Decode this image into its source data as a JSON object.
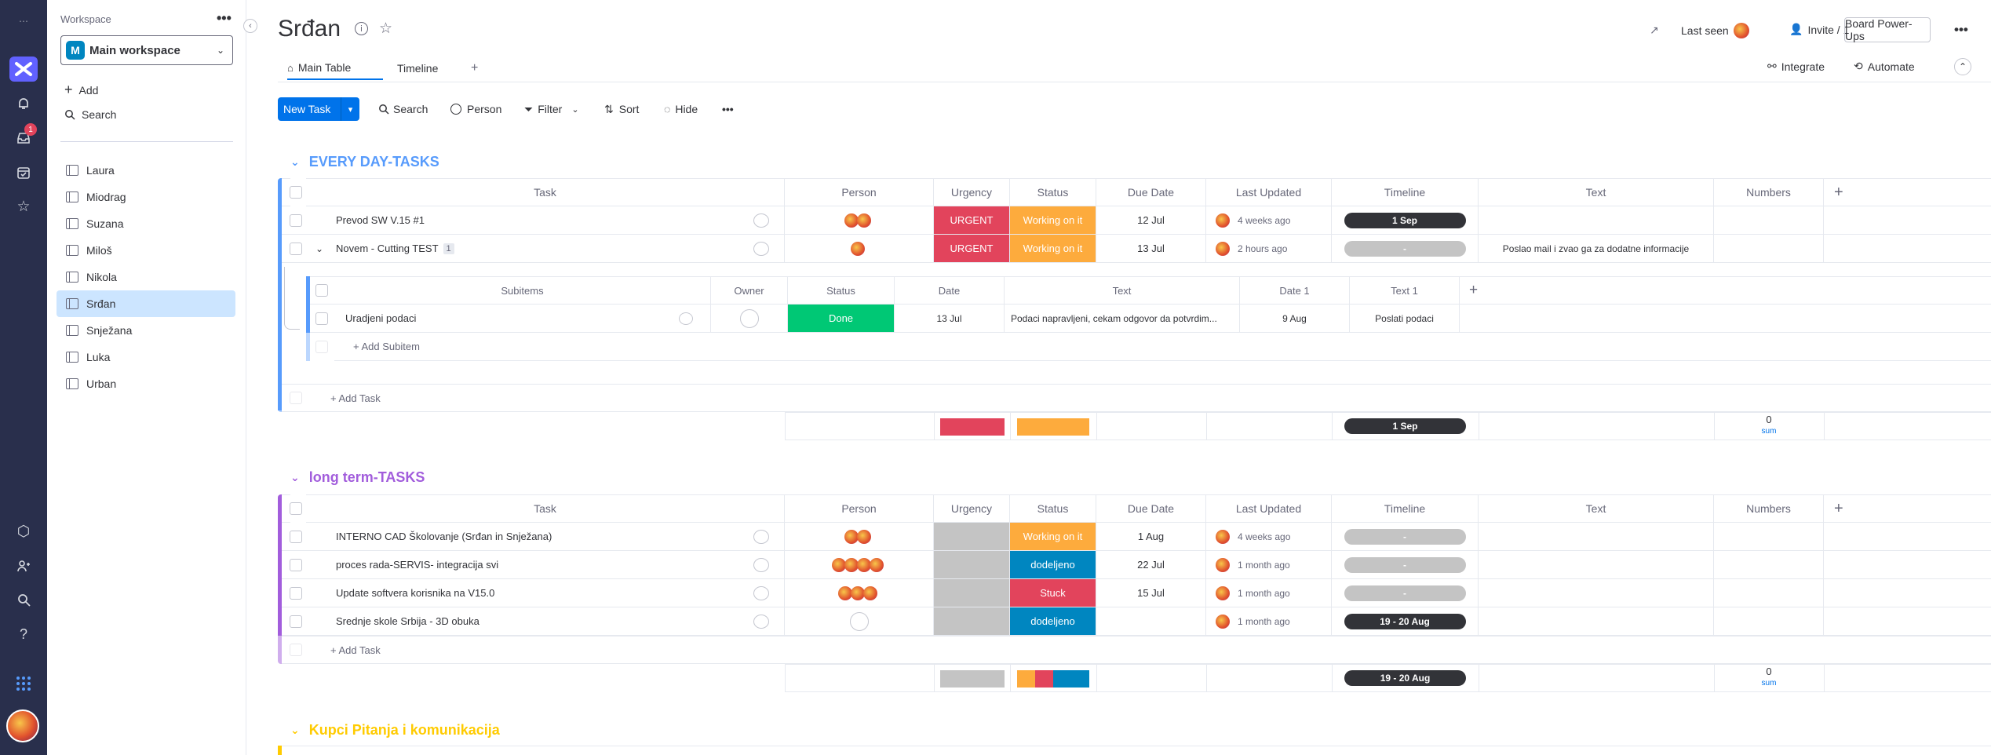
{
  "rail": {
    "badge": "1"
  },
  "sidebar": {
    "workspace_label": "Workspace",
    "workspace_name": "Main workspace",
    "workspace_initial": "M",
    "add_label": "Add",
    "search_label": "Search",
    "boards": [
      "Laura",
      "Miodrag",
      "Suzana",
      "Miloš",
      "Nikola",
      "Srđan",
      "Snježana",
      "Luka",
      "Urban"
    ],
    "selected": "Srđan"
  },
  "header": {
    "title": "Srđan",
    "last_seen": "Last seen",
    "invite": "Invite / 1",
    "power_ups": "Board Power-Ups",
    "tabs": [
      "Main Table",
      "Timeline",
      "+"
    ],
    "integrate": "Integrate",
    "automate": "Automate"
  },
  "toolbar": {
    "new_task": "New Task",
    "search": "Search",
    "person": "Person",
    "filter": "Filter",
    "sort": "Sort",
    "hide": "Hide"
  },
  "columns": [
    "Task",
    "Person",
    "Urgency",
    "Status",
    "Due Date",
    "Last Updated",
    "Timeline",
    "Text",
    "Numbers",
    "+"
  ],
  "colors": {
    "urgent": "#e2445c",
    "working": "#fdab3d",
    "done": "#00c875",
    "stuck": "#e2445c",
    "assigned": "#0086c0",
    "blank": "#c4c4c4",
    "group1": "#579bfc",
    "group2": "#a25ddc",
    "group3": "#ffcb00"
  },
  "groups": [
    {
      "title": "EVERY DAY-TASKS",
      "rows": [
        {
          "task": "Prevod SW V.15 #1",
          "urgency": "URGENT",
          "status": "Working on it",
          "due": "12 Jul",
          "updated": "4 weeks ago",
          "timeline": "1 Sep",
          "text": ""
        },
        {
          "task": "Novem - Cutting TEST",
          "sub_count": "1",
          "urgency": "URGENT",
          "status": "Working on it",
          "due": "13 Jul",
          "updated": "2 hours ago",
          "timeline": "-",
          "text": "Poslao mail i zvao ga za dodatne informacije"
        }
      ],
      "subitems": {
        "columns": [
          "Subitems",
          "Owner",
          "Status",
          "Date",
          "Text",
          "Date 1",
          "Text 1",
          "+"
        ],
        "rows": [
          {
            "name": "Uradjeni podaci",
            "status": "Done",
            "date": "13 Jul",
            "text": "Podaci napravljeni, cekam odgovor da potvrdim...",
            "date1": "9 Aug",
            "text1": "Poslati podaci"
          }
        ],
        "add": "+ Add Subitem"
      },
      "add_task": "+ Add Task",
      "summary": {
        "timeline": "1 Sep",
        "numbers": "0",
        "sum": "sum"
      }
    },
    {
      "title": "long term-TASKS",
      "rows": [
        {
          "task": "INTERNO CAD Školovanje (Srđan in Snježana)",
          "status": "Working on it",
          "due": "1 Aug",
          "updated": "4 weeks ago",
          "timeline": "-"
        },
        {
          "task": "proces rada-SERVIS- integracija svi",
          "status": "dodeljeno",
          "due": "22 Jul",
          "updated": "1 month ago",
          "timeline": "-"
        },
        {
          "task": "Update softvera korisnika na V15.0",
          "status": "Stuck",
          "due": "15 Jul",
          "updated": "1 month ago",
          "timeline": "-"
        },
        {
          "task": "Srednje skole Srbija - 3D obuka",
          "status": "dodeljeno",
          "due": "",
          "updated": "1 month ago",
          "timeline": "19 - 20 Aug"
        }
      ],
      "add_task": "+ Add Task",
      "summary": {
        "timeline": "19 - 20 Aug",
        "numbers": "0",
        "sum": "sum"
      }
    },
    {
      "title": "Kupci Pitanja i komunikacija"
    }
  ]
}
